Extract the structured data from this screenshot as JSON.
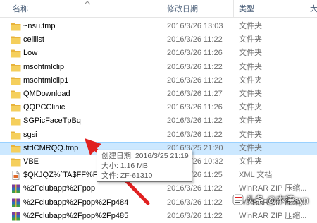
{
  "header": {
    "name_label": "名称",
    "date_label": "修改日期",
    "type_label": "类型",
    "size_label": "大"
  },
  "files": [
    {
      "name": "~nsu.tmp",
      "date": "2016/3/26 13:03",
      "type": "文件夹",
      "icon": "folder-icon"
    },
    {
      "name": "celllist",
      "date": "2016/3/26 11:22",
      "type": "文件夹",
      "icon": "folder-icon"
    },
    {
      "name": "Low",
      "date": "2016/3/26 11:26",
      "type": "文件夹",
      "icon": "folder-icon"
    },
    {
      "name": "msohtmlclip",
      "date": "2016/3/26 11:22",
      "type": "文件夹",
      "icon": "folder-icon"
    },
    {
      "name": "msohtmlclip1",
      "date": "2016/3/26 11:22",
      "type": "文件夹",
      "icon": "folder-icon"
    },
    {
      "name": "QMDownload",
      "date": "2016/3/26 11:27",
      "type": "文件夹",
      "icon": "folder-icon"
    },
    {
      "name": "QQPCClinic",
      "date": "2016/3/26 11:26",
      "type": "文件夹",
      "icon": "folder-icon"
    },
    {
      "name": "SGPicFaceTpBq",
      "date": "2016/3/26 11:22",
      "type": "文件夹",
      "icon": "folder-icon"
    },
    {
      "name": "sgsi",
      "date": "2016/3/26 11:22",
      "type": "文件夹",
      "icon": "folder-icon"
    },
    {
      "name": "stdCMRQQ.tmp",
      "date": "2016/3/25 21:20",
      "type": "文件夹",
      "icon": "folder-icon",
      "selected": true
    },
    {
      "name": "VBE",
      "date": "2016/3/26 10:32",
      "type": "文件夹",
      "icon": "folder-icon"
    },
    {
      "name": "$QKJQZ%`TA$FF%F(",
      "date": "2016/3/26 11:25",
      "type": "XML 文档",
      "icon": "xml-file-icon"
    },
    {
      "name": "%2Fclubapp%2Fpop",
      "date": "2016/3/26 11:22",
      "type": "WinRAR ZIP 压缩...",
      "icon": "winrar-icon"
    },
    {
      "name": "%2Fclubapp%2Fpop%2Fp484",
      "date": "2016/3/26 11:22",
      "type": "WinRAR ZIP 压缩...",
      "icon": "winrar-icon"
    },
    {
      "name": "%2Fclubapp%2Fpop%2Fp485",
      "date": "2016/3/26 11:22",
      "type": "WinRAR ZIP 压缩...",
      "icon": "winrar-icon"
    }
  ],
  "tooltip": {
    "created": "创建日期: 2016/3/25 21:19",
    "size": "大小: 1.16 MB",
    "files": "文件: ZF-61310"
  },
  "watermark": "头条 @本德syn",
  "colors": {
    "folder": "#f5cf5c",
    "selection": "#cce8ff",
    "arrow": "#e02020"
  }
}
